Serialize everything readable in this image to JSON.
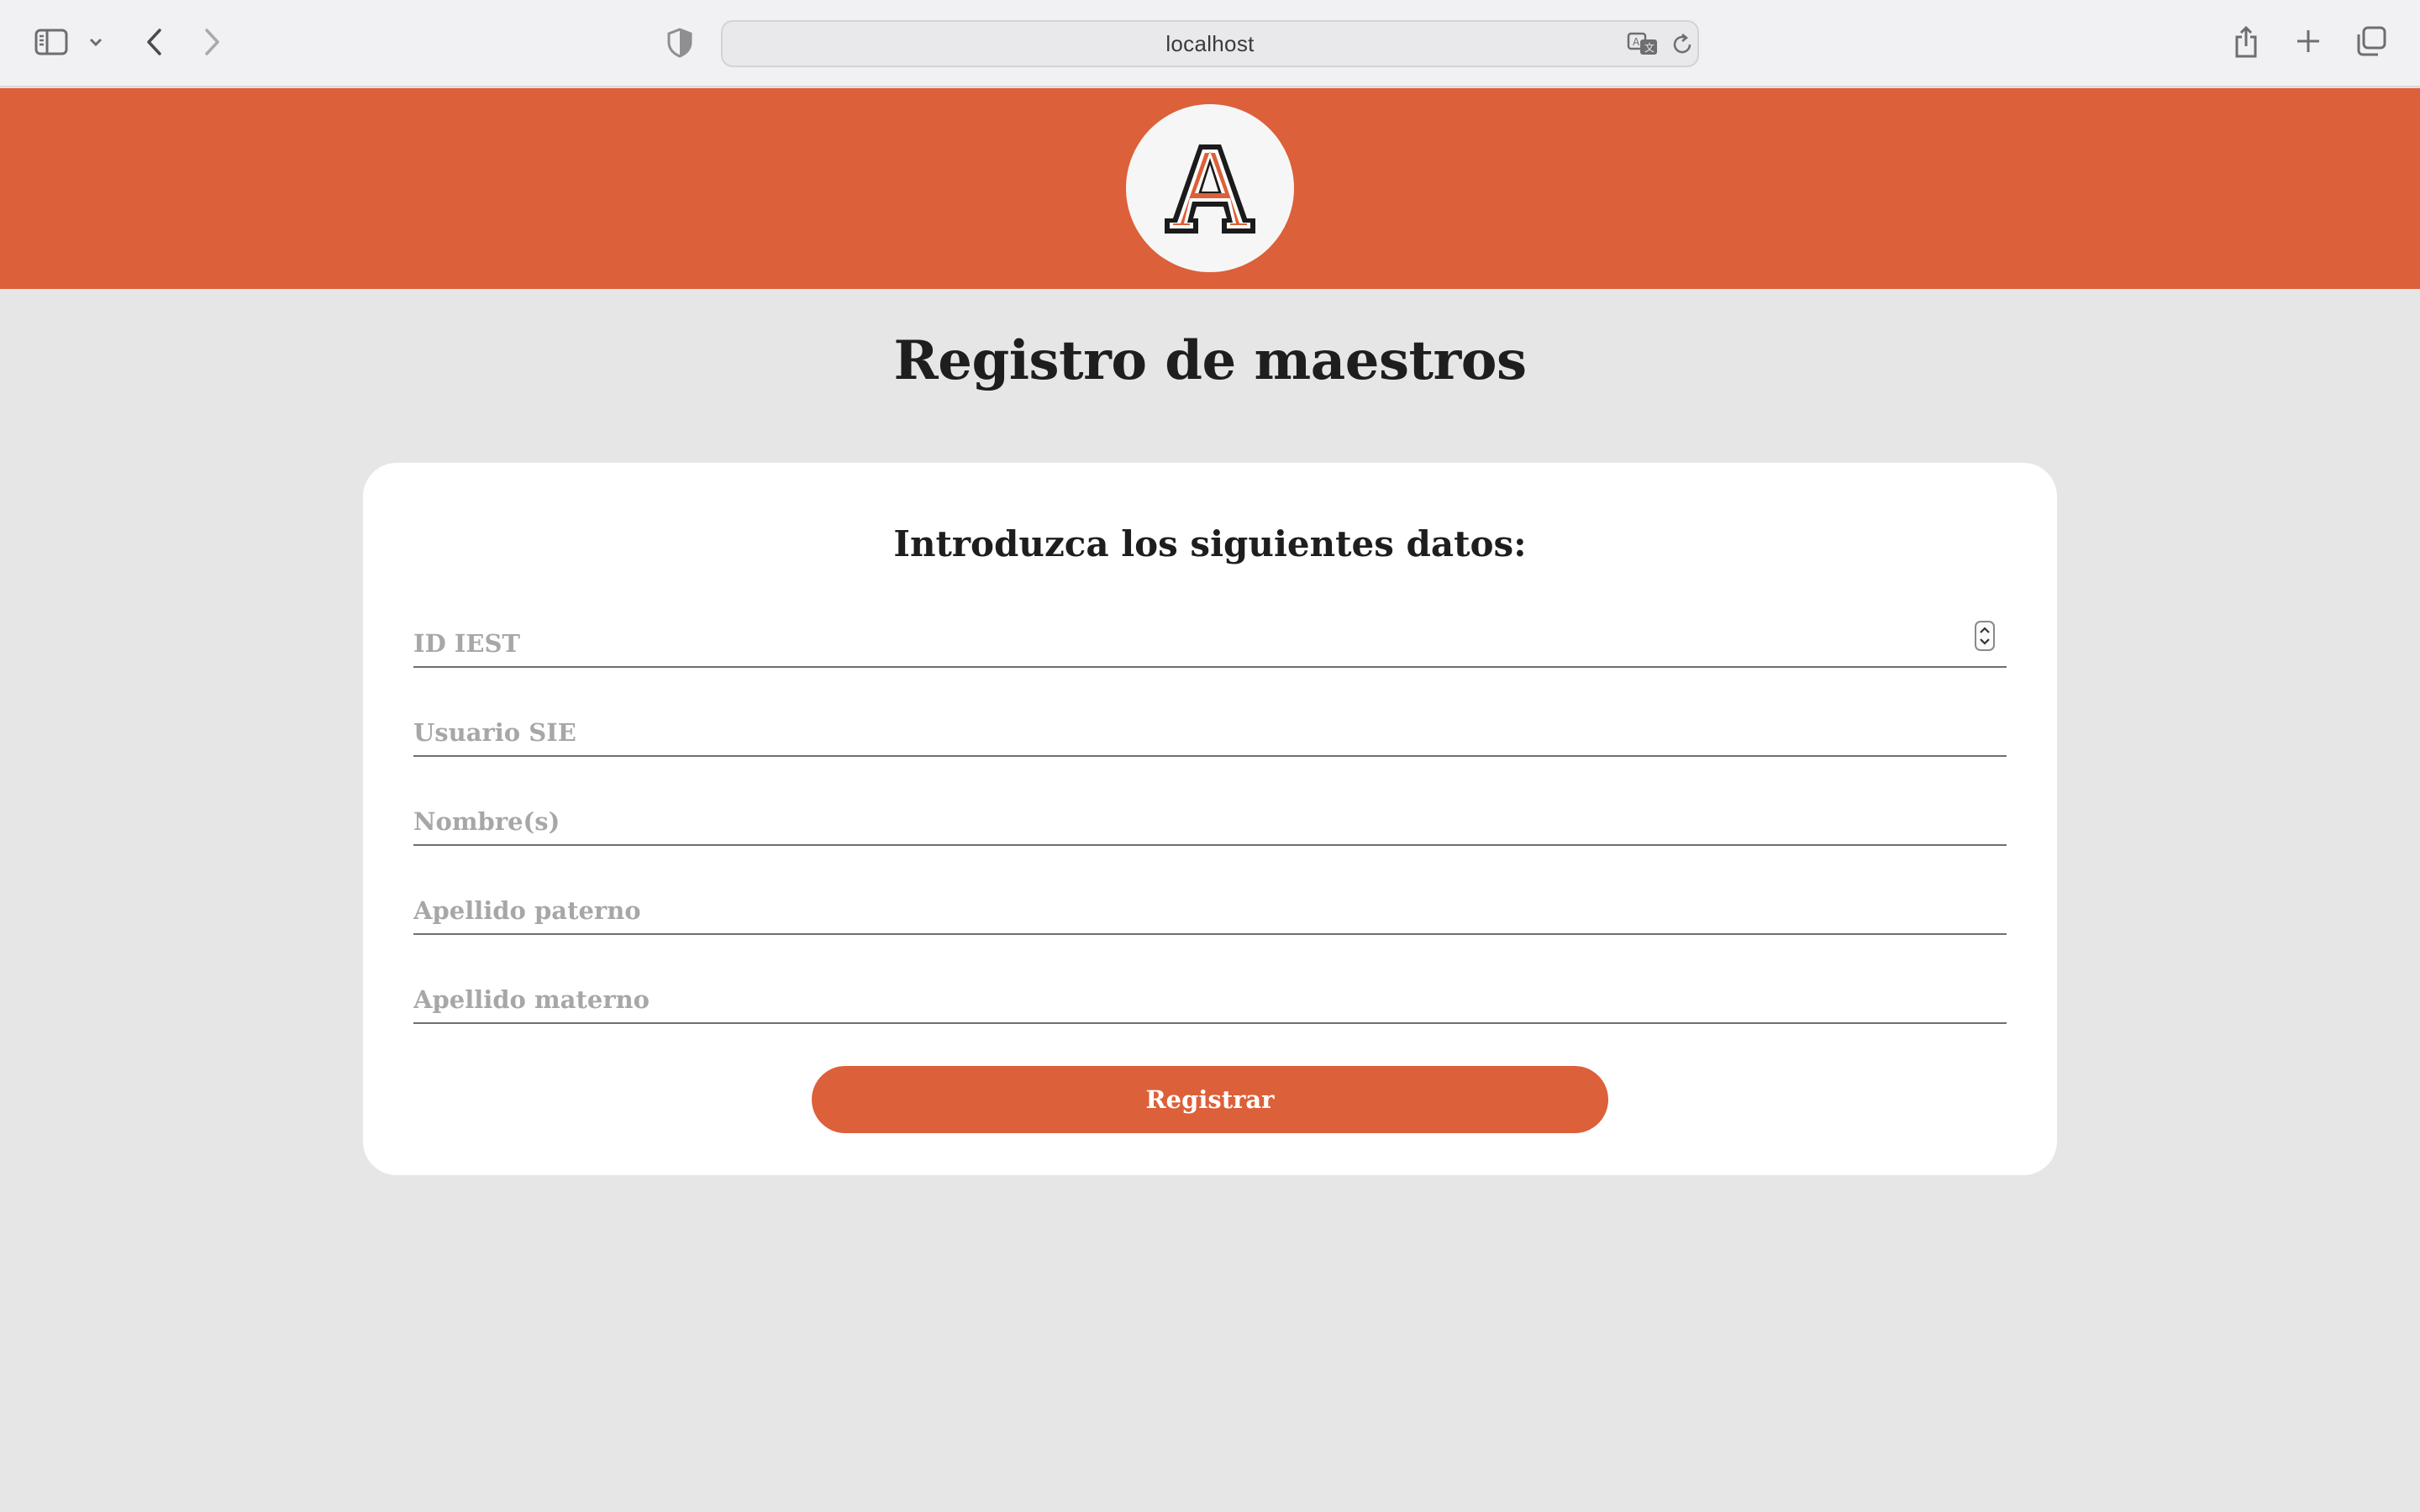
{
  "browser": {
    "url": "localhost",
    "toolbar_icons": [
      "sidebar-icon",
      "chevron-down-icon",
      "back-icon",
      "forward-icon",
      "shield-icon",
      "translate-icon",
      "reload-icon",
      "share-icon",
      "new-tab-icon",
      "tabs-overview-icon"
    ]
  },
  "header": {
    "logo_letter": "A",
    "brand_color": "#dc6039"
  },
  "page": {
    "title": "Registro de maestros"
  },
  "form": {
    "heading": "Introduzca los siguientes datos:",
    "fields": [
      {
        "placeholder": "ID IEST",
        "value": "",
        "type": "number"
      },
      {
        "placeholder": "Usuario SIE",
        "value": ""
      },
      {
        "placeholder": "Nombre(s)",
        "value": ""
      },
      {
        "placeholder": "Apellido paterno",
        "value": ""
      },
      {
        "placeholder": "Apellido materno",
        "value": ""
      }
    ],
    "submit_label": "Registrar"
  },
  "colors": {
    "accent": "#dc6039",
    "background": "#e6e6e6",
    "card": "#ffffff",
    "text": "#1e1e1e",
    "placeholder": "#a7a7a7"
  }
}
